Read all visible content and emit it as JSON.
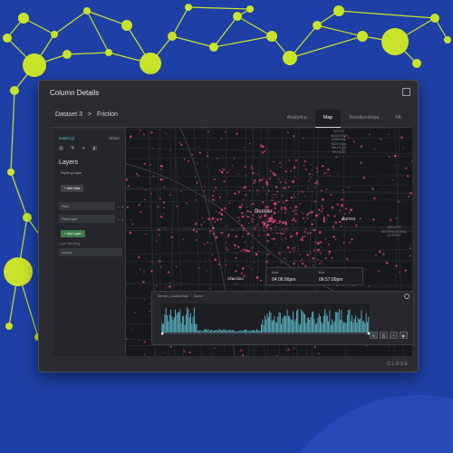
{
  "modal": {
    "title": "Column Details",
    "close_label": "CLOSE"
  },
  "breadcrumb": {
    "dataset": "Dataset 3",
    "separator": ">",
    "column": "Friction"
  },
  "tabs": [
    {
      "label": "Analytics",
      "active": false
    },
    {
      "label": "Map",
      "active": true
    },
    {
      "label": "Relationships",
      "active": false
    },
    {
      "label": "ML",
      "active": false
    }
  ],
  "panel": {
    "logo": "kepler.gl",
    "share": "Share",
    "heading": "Layers",
    "layer_name": "Kepler.gl Layer",
    "add_data": "+ Add Data",
    "row1": "Point",
    "row2": "Point Layer",
    "add_layer": "+ Add Layer",
    "label_base": "Layer Blending",
    "select_value": "normal"
  },
  "map": {
    "labels": {
      "city": "Denver",
      "aurora": "Aurora",
      "sheridan": "Sheridan"
    },
    "small_labels": {
      "arsenal": "ROCKY\nMOUNTAIN\nARSENAL\nNATIONAL\nWILDLIFE\nREFUGE",
      "airport": "DENVER\nINTERNATIONAL\nAIRPORT"
    },
    "tooltip": {
      "start_label": "Start",
      "start_value": "04:06:00pm",
      "end_label": "End",
      "end_value": "06:57:00pm"
    }
  },
  "timeline": {
    "field": "Denver_LocationData",
    "speed": "Speed"
  },
  "colors": {
    "background": "#1e3fa6",
    "node": "#c9e32b",
    "accent": "#5bb6c9",
    "points": "#e0447a"
  }
}
